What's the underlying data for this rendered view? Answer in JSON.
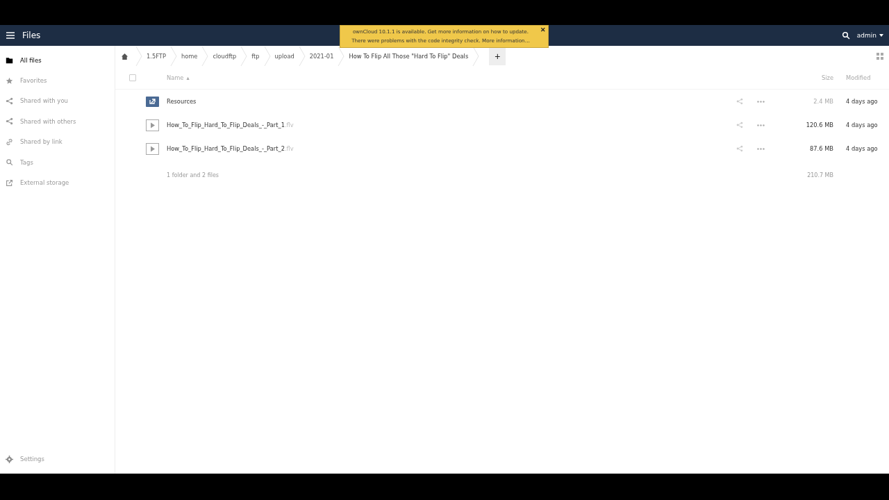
{
  "header": {
    "app_title": "Files",
    "user": "admin"
  },
  "notification": {
    "lines": [
      "ownCloud 10.1.1 is available. Get more information on how to update.",
      "There were problems with the code integrity check. More information…"
    ],
    "close": "✕"
  },
  "sidebar": {
    "items": [
      {
        "kind": "folder",
        "label": "All files",
        "selected": true
      },
      {
        "kind": "star",
        "label": "Favorites",
        "selected": false
      },
      {
        "kind": "share",
        "label": "Shared with you",
        "selected": false
      },
      {
        "kind": "share",
        "label": "Shared with others",
        "selected": false
      },
      {
        "kind": "link",
        "label": "Shared by link",
        "selected": false
      },
      {
        "kind": "tag",
        "label": "Tags",
        "selected": false
      },
      {
        "kind": "external",
        "label": "External storage",
        "selected": false
      }
    ],
    "settings": "Settings"
  },
  "breadcrumbs": [
    "1.5FTP",
    "home",
    "cloudftp",
    "ftp",
    "upload",
    "2021-01",
    "How To Flip All Those \"Hard To Flip\" Deals"
  ],
  "new_button": "+",
  "table": {
    "columns": [
      "Name",
      "Size",
      "Modified"
    ],
    "sort_indicator": "▴",
    "select_all_checked": false,
    "rows": [
      {
        "kind": "folder",
        "name": "Resources",
        "size": "2.4 MB",
        "modified": "4 days ago"
      },
      {
        "kind": "video",
        "name": "How_To_Flip_Hard_To_Flip_Deals_-_Part_1",
        "extension": ".flv",
        "size": "120.6 MB",
        "modified": "4 days ago"
      },
      {
        "kind": "video",
        "name": "How_To_Flip_Hard_To_Flip_Deals_-_Part_2",
        "extension": ".flv",
        "size": "87.6 MB",
        "modified": "4 days ago"
      }
    ],
    "summary": "1 folder and 2 files",
    "total_size": "210.7 MB"
  }
}
